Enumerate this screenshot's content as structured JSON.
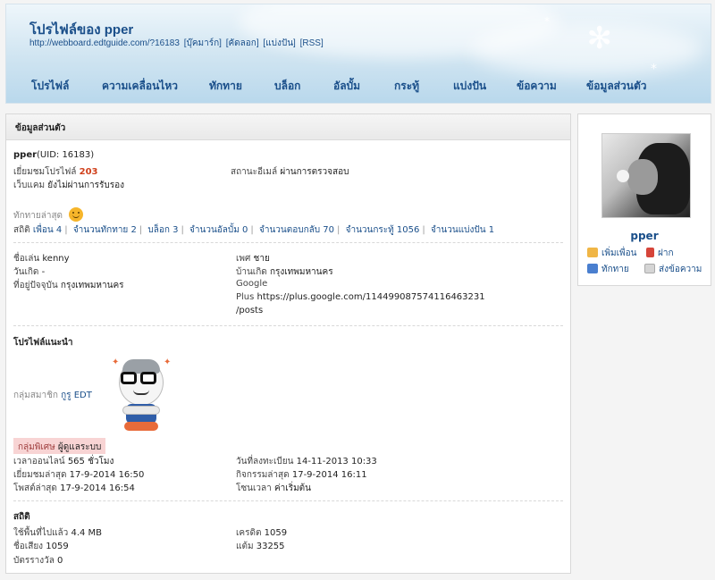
{
  "header": {
    "title": "โปรไฟล์ของ pper",
    "url": "http://webboard.edtguide.com/?16183",
    "links": [
      "[บุ๊คมาร์ก]",
      "[คัดลอก]",
      "[แบ่งปัน]",
      "[RSS]"
    ]
  },
  "nav": [
    "โปรไฟล์",
    "ความเคลื่อนไหว",
    "ทักทาย",
    "บล็อก",
    "อัลบั้ม",
    "กระทู้",
    "แบ่งปัน",
    "ข้อความ",
    "ข้อมูลส่วนตัว"
  ],
  "main": {
    "section_title": "ข้อมูลส่วนตัว",
    "username": "pper",
    "uid": "(UID: 16183)",
    "profile_views_label": "เยี่ยมชมโปรไฟล์",
    "profile_views": "203",
    "email_status_label": "สถานะอีเมล์",
    "email_status": "ผ่านการตรวจสอบ",
    "webcam_label": "เว็บแคม",
    "webcam_status": "ยังไม่ผ่านการรับรอง",
    "latest_greeting_label": "ทักทายล่าสุด",
    "stats_label": "สถิติ",
    "stats": [
      "เพื่อน 4",
      "จำนวนทักทาย 2",
      "บล็อก 3",
      "จำนวนอัลบั้ม 0",
      "จำนวนตอบกลับ 70",
      "จำนวนกระทู้ 1056",
      "จำนวนแบ่งปัน 1"
    ],
    "nickname_label": "ชื่อเล่น",
    "nickname": "kenny",
    "gender_label": "เพศ",
    "gender": "ชาย",
    "birthday_label": "วันเกิด",
    "birthday": "-",
    "hometown_label": "บ้านเกิด",
    "hometown": "กรุงเทพมหานคร",
    "residence_label": "ที่อยู่ปัจจุบัน",
    "residence": "กรุงเทพมหานคร",
    "google_label_1": "Google",
    "google_label_2": "Plus",
    "google_url_1": "https://plus.google.com/114499087574116463231",
    "google_url_2": "/posts",
    "recommend_title": "โปรไฟล์แนะนำ",
    "group_label": "กลุ่มสมาชิก",
    "group": "กูรู EDT",
    "special_group_label": "กลุ่มพิเศษ",
    "special_group": "ผู้ดูแลระบบ",
    "online_time_label": "เวลาออนไลน์",
    "online_time": "565 ชั่วโมง",
    "register_date_label": "วันที่ลงทะเบียน",
    "register_date": "14-11-2013 10:33",
    "last_visit_label": "เยี่ยมชมล่าสุด",
    "last_visit": "17-9-2014 16:50",
    "last_activity_label": "กิจกรรมล่าสุด",
    "last_activity": "17-9-2014 16:11",
    "last_post_label": "โพสต์ล่าสุด",
    "last_post": "17-9-2014 16:54",
    "timezone_label": "โซนเวลา",
    "timezone": "ค่าเริ่มต้น",
    "stats_section_title": "สถิติ",
    "space_used_label": "ใช้พื้นที่ไปแล้ว",
    "space_used": "4.4 MB",
    "credit_label": "เครดิต",
    "credit": "1059",
    "reputation_label": "ชื่อเสียง",
    "reputation": "1059",
    "points_label": "แต้ม",
    "points": "33255",
    "tickets_label": "บัตรรางวัล",
    "tickets": "0"
  },
  "sidebar": {
    "name": "pper",
    "add_friend": "เพิ่มเพื่อน",
    "deposit": "ฝาก",
    "greet": "ทักทาย",
    "send_message": "ส่งข้อความ"
  },
  "colors": {
    "link": "#1a4f8a",
    "highlight": "#d0401b",
    "special_bg": "#f8d4d4"
  }
}
